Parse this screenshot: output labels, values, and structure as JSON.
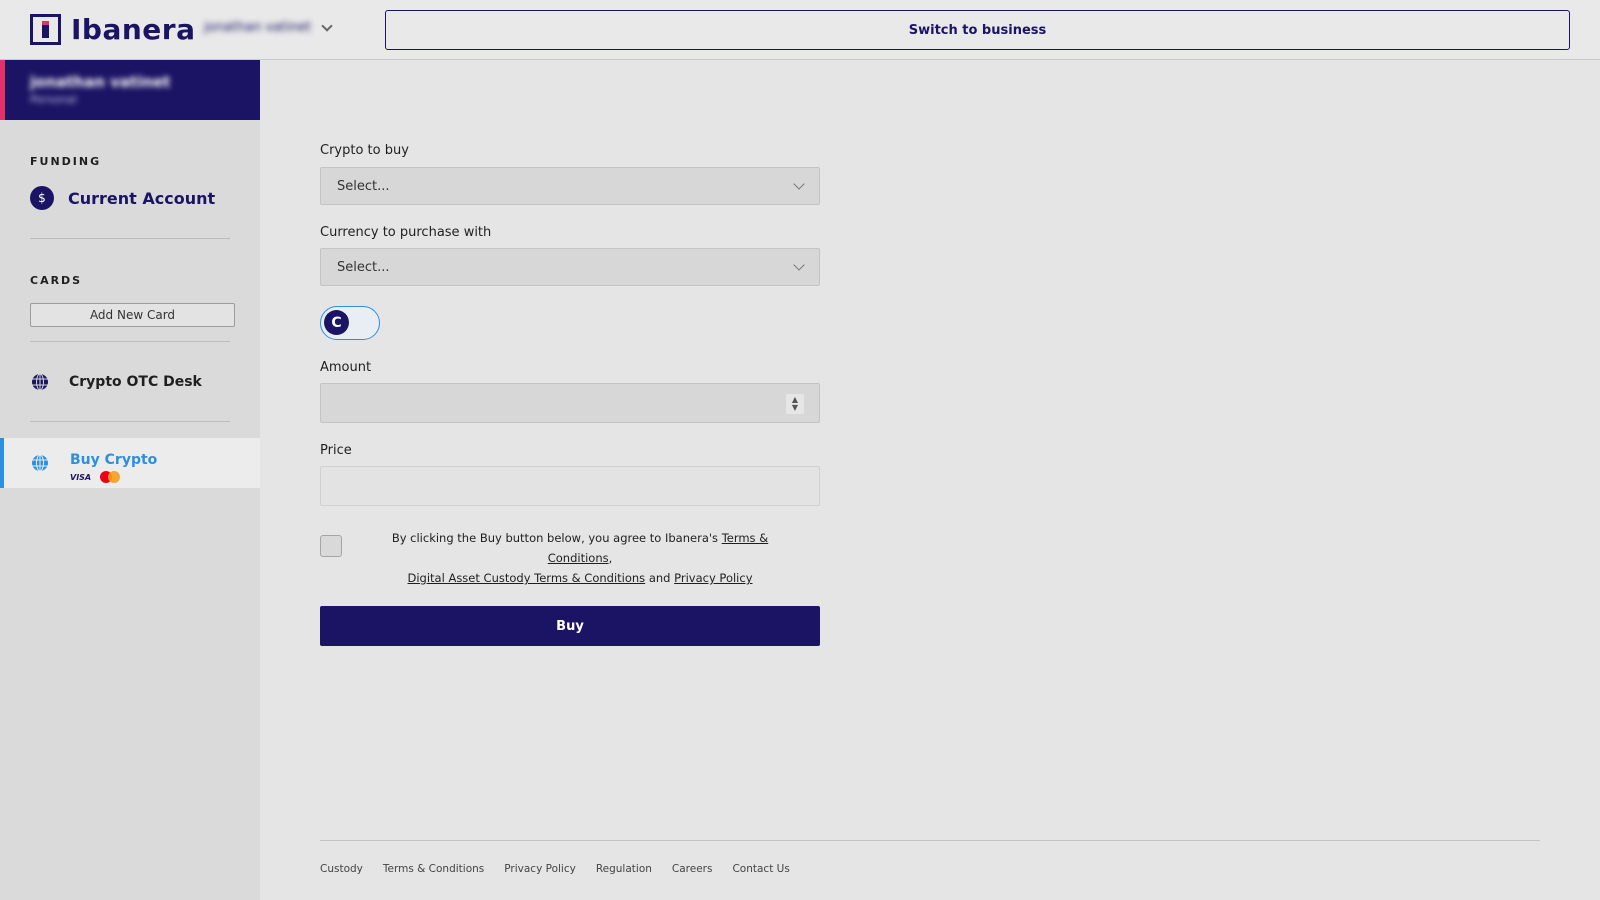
{
  "header": {
    "brand": "Ibanera",
    "user_name": "jonathan vatinet",
    "switch_label": "Switch to business"
  },
  "sidebar": {
    "profile": {
      "name": "jonathan vatinet",
      "type": "Personal"
    },
    "funding_label": "FUNDING",
    "current_account": "Current Account",
    "cards_label": "CARDS",
    "add_card": "Add New Card",
    "otc_desk": "Crypto OTC Desk",
    "buy_crypto": "Buy Crypto",
    "visa": "VISA"
  },
  "form": {
    "crypto_label": "Crypto to buy",
    "crypto_value": "Select...",
    "currency_label": "Currency to purchase with",
    "currency_value": "Select...",
    "toggle_symbol": "C",
    "amount_label": "Amount",
    "amount_value": "",
    "price_label": "Price",
    "price_value": "",
    "agree_prefix": "By clicking the Buy button below, you agree to Ibanera's ",
    "terms_link": "Terms & Conditions",
    "comma": ",",
    "custody_link": "Digital Asset Custody Terms & Conditions",
    "and": " and ",
    "privacy_link": "Privacy Policy",
    "buy_label": "Buy"
  },
  "footer": {
    "links": [
      "Custody",
      "Terms & Conditions",
      "Privacy Policy",
      "Regulation",
      "Careers",
      "Contact Us"
    ]
  },
  "colors": {
    "brand": "#1b1464",
    "accent": "#2d8fe0",
    "profile_stripe": "#e3306a"
  }
}
